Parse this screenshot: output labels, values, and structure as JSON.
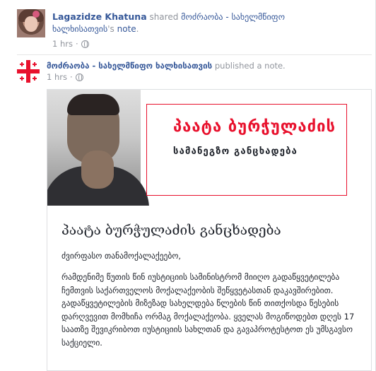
{
  "share": {
    "author": "Lagazidze Khatuna",
    "verb": "shared",
    "page": "მოძრაობა - სახელმწიფო ხალხისათვის",
    "possessive": "'s",
    "object": "note",
    "period": ".",
    "time": "1 hrs"
  },
  "post": {
    "page": "მოძრაობა - სახელმწიფო ხალხისათვის",
    "verb": "published a note.",
    "time": "1 hrs"
  },
  "banner": {
    "title": "პაატა ბურჭულაძის",
    "subtitle": "სამანეგზო განცხადება",
    "accent": "#e8112d"
  },
  "note": {
    "title": "პაატა ბურჭულაძის განცხადება",
    "greeting": "ძვირფასო თანამოქალაქეებო,",
    "body": "რამდენიმე წუთის წინ იუსტიციის სამინისტრომ მიიღო გადაწყვეტილება ჩემთვის საქართველოს მოქალაქეობის შეწყვეტასთან დაკავშირებით. გადაწყვეტილების მიზეზად სახელდება წლების წინ თითქოსდა წესების დარღვევით მომხიჩა ორმაგ მოქალაქეობა. ყველას მოგიწოდებთ დღეს 17 საათზე შევიკრიბოთ იუსტიციის სახლთან და გავაპროტესტოთ ეს უმსგავსო საქციელი."
  },
  "colors": {
    "link": "#365899",
    "muted": "#90949c",
    "flag_red": "#e8112d"
  }
}
